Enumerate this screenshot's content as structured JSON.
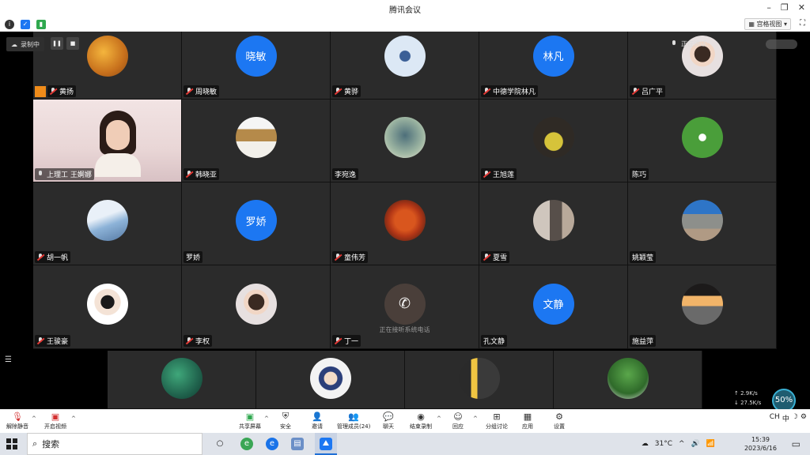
{
  "window": {
    "title": "腾讯会议"
  },
  "infobar": {
    "view_label": "宫格视图"
  },
  "recording": {
    "label": "录制中"
  },
  "speaking": {
    "label": "正在讲话:"
  },
  "grid": [
    {
      "name": "黄扬",
      "avatar": "img-autumn",
      "host": true
    },
    {
      "name": "周晓敏",
      "avatar_text": "晓敏"
    },
    {
      "name": "黄骅",
      "avatar": "img-snowbird"
    },
    {
      "name": "中德学院林凡",
      "avatar_text": "林凡"
    },
    {
      "name": "吕广平",
      "avatar": "img-girl2",
      "partial": true
    },
    {
      "name": "上理工 王婀娜",
      "video": true,
      "mic_on": true
    },
    {
      "name": "韩晓亚",
      "avatar": "img-curtain"
    },
    {
      "name": "李宛逸",
      "avatar": "img-girlsbed",
      "no_mic": true
    },
    {
      "name": "王旭莲",
      "avatar": "img-child"
    },
    {
      "name": "陈巧",
      "avatar": "img-flower",
      "no_mic": true
    },
    {
      "name": "胡一帆",
      "avatar": "img-plane"
    },
    {
      "name": "罗娇",
      "avatar_text": "罗娇",
      "no_mic": true
    },
    {
      "name": "童伟芳",
      "avatar": "img-crab"
    },
    {
      "name": "夏雪",
      "avatar": "img-couple"
    },
    {
      "name": "姚颖莹",
      "avatar": "img-stair",
      "no_mic": true
    },
    {
      "name": "王骏豪",
      "avatar": "img-boy"
    },
    {
      "name": "李权",
      "avatar": "img-girl2"
    },
    {
      "name": "丁一",
      "phone": true,
      "status": "正在接听系统电话"
    },
    {
      "name": "孔文静",
      "avatar_text": "文静",
      "no_mic": true
    },
    {
      "name": "施益萍",
      "avatar": "img-sunset",
      "no_mic": true
    }
  ],
  "strip": [
    {
      "avatar": "img-aerial"
    },
    {
      "avatar": "img-baby"
    },
    {
      "avatar": "img-room"
    },
    {
      "avatar": "img-tree"
    }
  ],
  "netstat": {
    "up": "2.9K/s",
    "down": "27.5K/s",
    "percent": "50%"
  },
  "toolbar": {
    "unmute": "解除静音",
    "start_video": "开启视频",
    "share_screen": "共享屏幕",
    "security": "安全",
    "invite": "邀请",
    "manage_members": "管理成员(24)",
    "chat": "聊天",
    "end_recording": "结束录制",
    "react": "回应",
    "breakout": "分组讨论",
    "apps": "应用",
    "settings": "设置"
  },
  "ime": {
    "lang": "CH",
    "mode": "中"
  },
  "taskbar": {
    "search_placeholder": "搜索",
    "temperature": "31°C",
    "time": "15:39",
    "date": "2023/6/16"
  }
}
